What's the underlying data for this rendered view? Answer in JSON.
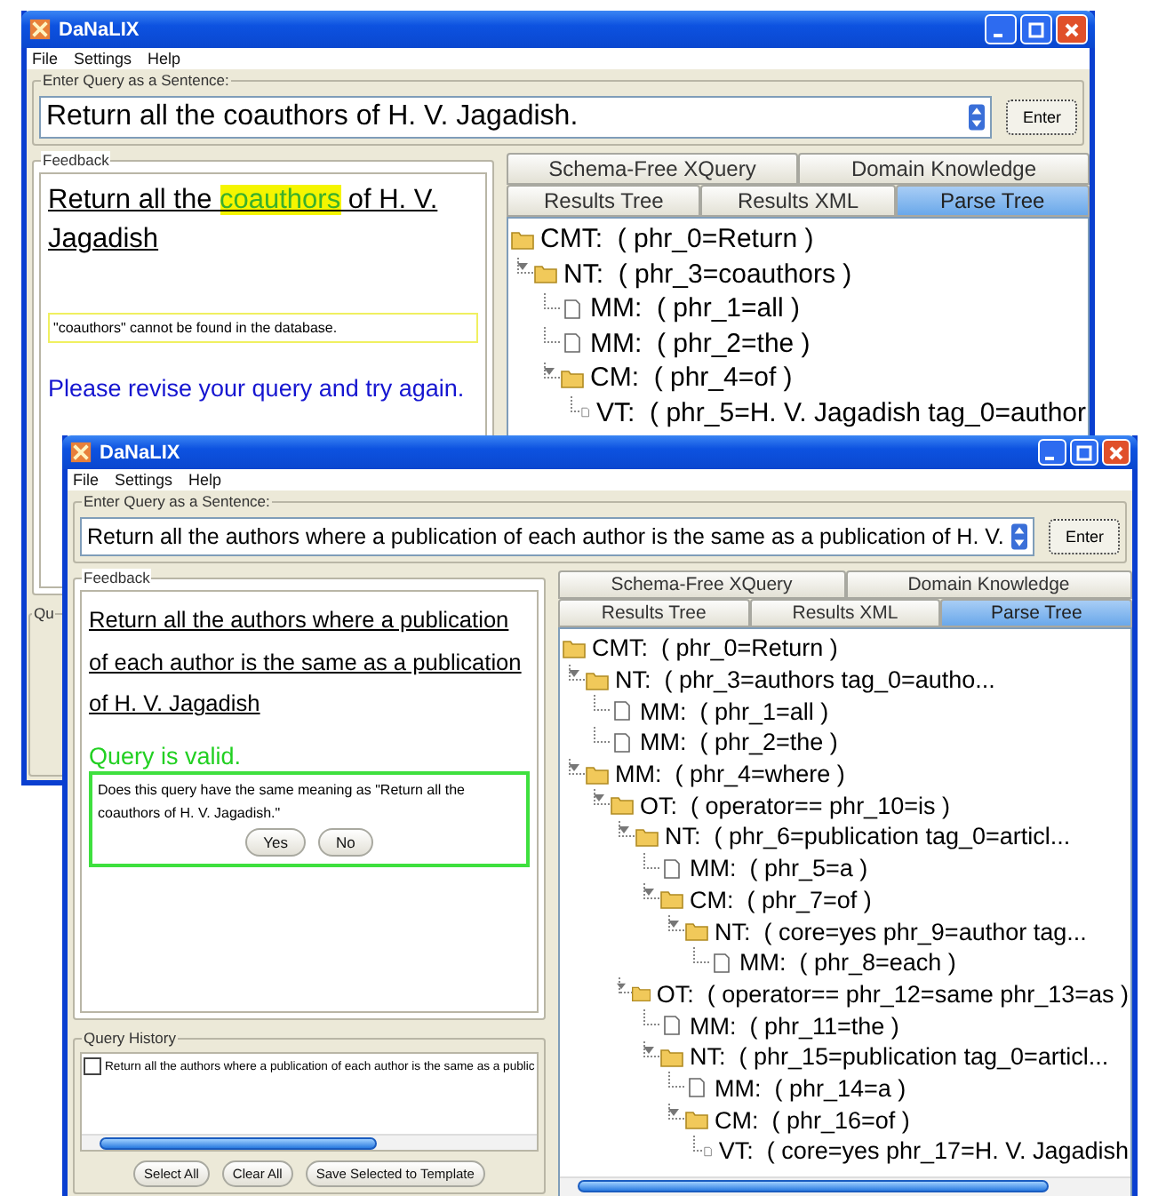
{
  "back_window": {
    "title": "DaNaLIX",
    "menu": [
      "File",
      "Settings",
      "Help"
    ],
    "query_label": "Enter Query as a Sentence:",
    "query": "Return all the coauthors of H. V. Jagadish.",
    "enter_button": "Enter",
    "feedback": {
      "label": "Feedback",
      "sentence": [
        {
          "text": "Return all the ",
          "kind": "plain"
        },
        {
          "text": "coauthors",
          "kind": "highlight"
        },
        {
          "text": " of H. V. Jagadish ",
          "kind": "plain"
        }
      ],
      "note": "\"coauthors\" cannot be found in the database.",
      "status": {
        "text": "Please revise your query and try again.",
        "kind": "error"
      }
    },
    "history_label": "Qu",
    "tabs": [
      [
        {
          "label": "Schema-Free XQuery",
          "selected": false
        },
        {
          "label": "Domain Knowledge",
          "selected": false
        }
      ],
      [
        {
          "label": "Results Tree",
          "selected": false
        },
        {
          "label": "Results XML",
          "selected": false
        },
        {
          "label": "Parse Tree",
          "selected": true
        }
      ]
    ],
    "tree": [
      {
        "label": "CMT:  ( phr_0=Return )",
        "kind": "folder",
        "children": [
          {
            "label": "NT:  ( phr_3=coauthors )",
            "kind": "folder",
            "children": [
              {
                "label": "MM:  ( phr_1=all )",
                "kind": "leaf"
              },
              {
                "label": "MM:  ( phr_2=the )",
                "kind": "leaf"
              },
              {
                "label": "CM:  ( phr_4=of )",
                "kind": "folder",
                "children": [
                  {
                    "label": "VT:  ( phr_5=H. V. Jagadish tag_0=author",
                    "kind": "leaf"
                  }
                ]
              }
            ]
          }
        ]
      }
    ]
  },
  "front_window": {
    "title": "DaNaLIX",
    "menu": [
      "File",
      "Settings",
      "Help"
    ],
    "query_label": "Enter Query as a Sentence:",
    "query": "Return all the authors where a publication of each author is the same as a publication of H. V.",
    "enter_button": "Enter",
    "feedback": {
      "label": "Feedback",
      "sentence": [
        {
          "text": "Return all the authors where a publication of each author is the same as a publication of H. V. Jagadish ",
          "kind": "plain"
        }
      ],
      "status": {
        "text": "Query is valid.",
        "kind": "valid"
      },
      "confirm": {
        "question": "Does this query have the same meaning as \"Return all the coauthors of H. V. Jagadish.\"",
        "buttons": [
          "Yes",
          "No"
        ]
      }
    },
    "history": {
      "label": "Query History",
      "items": [
        {
          "text": "Return all the authors where a publication of each author is the same as a public",
          "checked": false
        }
      ],
      "buttons": [
        "Select All",
        "Clear All",
        "Save Selected to Template"
      ]
    },
    "tabs": [
      [
        {
          "label": "Schema-Free XQuery",
          "selected": false
        },
        {
          "label": "Domain Knowledge",
          "selected": false
        }
      ],
      [
        {
          "label": "Results Tree",
          "selected": false
        },
        {
          "label": "Results XML",
          "selected": false
        },
        {
          "label": "Parse Tree",
          "selected": true
        }
      ]
    ],
    "tree": [
      {
        "label": "CMT:  ( phr_0=Return )",
        "kind": "folder",
        "children": [
          {
            "label": "NT:  ( phr_3=authors tag_0=autho...",
            "kind": "folder",
            "children": [
              {
                "label": "MM:  ( phr_1=all )",
                "kind": "leaf"
              },
              {
                "label": "MM:  ( phr_2=the )",
                "kind": "leaf"
              }
            ]
          },
          {
            "label": "MM:  ( phr_4=where )",
            "kind": "folder",
            "children": [
              {
                "label": "OT:  ( operator== phr_10=is )",
                "kind": "folder",
                "children": [
                  {
                    "label": "NT:  ( phr_6=publication tag_0=articl...",
                    "kind": "folder",
                    "children": [
                      {
                        "label": "MM:  ( phr_5=a )",
                        "kind": "leaf"
                      },
                      {
                        "label": "CM:  ( phr_7=of )",
                        "kind": "folder",
                        "children": [
                          {
                            "label": "NT:  ( core=yes phr_9=author tag...",
                            "kind": "folder",
                            "children": [
                              {
                                "label": "MM:  ( phr_8=each )",
                                "kind": "leaf"
                              }
                            ]
                          }
                        ]
                      }
                    ]
                  },
                  {
                    "label": "OT:  ( operator== phr_12=same phr_13=as )",
                    "kind": "folder",
                    "children": [
                      {
                        "label": "MM:  ( phr_11=the )",
                        "kind": "leaf"
                      },
                      {
                        "label": "NT:  ( phr_15=publication tag_0=articl...",
                        "kind": "folder",
                        "children": [
                          {
                            "label": "MM:  ( phr_14=a )",
                            "kind": "leaf"
                          },
                          {
                            "label": "CM:  ( phr_16=of )",
                            "kind": "folder",
                            "children": [
                              {
                                "label": "VT:  ( core=yes phr_17=H. V. Jagadish",
                                "kind": "leaf"
                              }
                            ]
                          }
                        ]
                      }
                    ]
                  }
                ]
              }
            ]
          }
        ]
      }
    ]
  }
}
